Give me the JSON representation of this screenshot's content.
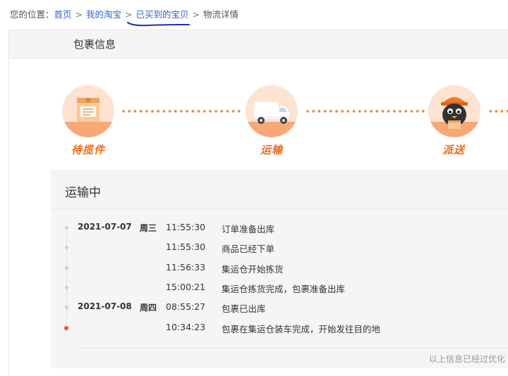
{
  "breadcrumb": {
    "prefix": "您的位置：",
    "items": [
      "首页",
      "我的淘宝",
      "已买到的宝贝",
      "物流详情"
    ],
    "separator": ">"
  },
  "package": {
    "title": "包裹信息"
  },
  "steps": [
    {
      "label": "待揽件",
      "icon": "package-box-icon"
    },
    {
      "label": "运输",
      "icon": "delivery-truck-icon"
    },
    {
      "label": "派送",
      "icon": "courier-mascot-icon"
    }
  ],
  "status": {
    "title": "运输中",
    "events": [
      {
        "date": "2021-07-07",
        "weekday": "周三",
        "time": "11:55:30",
        "desc": "订单准备出库",
        "active": false
      },
      {
        "date": "",
        "weekday": "",
        "time": "11:55:30",
        "desc": "商品已经下单",
        "active": false
      },
      {
        "date": "",
        "weekday": "",
        "time": "11:56:33",
        "desc": "集运仓开始拣货",
        "active": false
      },
      {
        "date": "",
        "weekday": "",
        "time": "15:00:21",
        "desc": "集运仓拣货完成，包裹准备出库",
        "active": false
      },
      {
        "date": "2021-07-08",
        "weekday": "周四",
        "time": "08:55:27",
        "desc": "包裹已出库",
        "active": false
      },
      {
        "date": "",
        "weekday": "",
        "time": "10:34:23",
        "desc": "包裹在集运仓装车完成，开始发往目的地",
        "active": true
      }
    ],
    "note": "以上信息已经过优化"
  },
  "colors": {
    "accent": "#f06a1a",
    "link": "#3366cc",
    "annotation": "#1a2eb8"
  }
}
